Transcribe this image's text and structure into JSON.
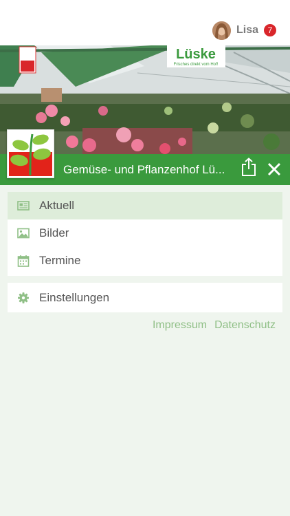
{
  "user": {
    "name": "Lisa",
    "notification_count": "7"
  },
  "header": {
    "title": "Gemüse- und Pflanzenhof Lü..."
  },
  "menu": {
    "main_items": [
      {
        "label": "Aktuell",
        "icon": "newspaper-icon",
        "active": true
      },
      {
        "label": "Bilder",
        "icon": "image-icon",
        "active": false
      },
      {
        "label": "Termine",
        "icon": "calendar-icon",
        "active": false
      }
    ],
    "settings_label": "Einstellungen"
  },
  "footer": {
    "impressum": "Impressum",
    "datenschutz": "Datenschutz"
  },
  "hero": {
    "sign_text": "Lüske",
    "sign_subtext": "Frisches direkt vom Hof!"
  },
  "colors": {
    "brand_green": "#3a9a3d",
    "active_bg": "#deedda",
    "link_green": "#8fbf86",
    "badge_red": "#d9262b",
    "page_bg": "#eff5ee"
  }
}
